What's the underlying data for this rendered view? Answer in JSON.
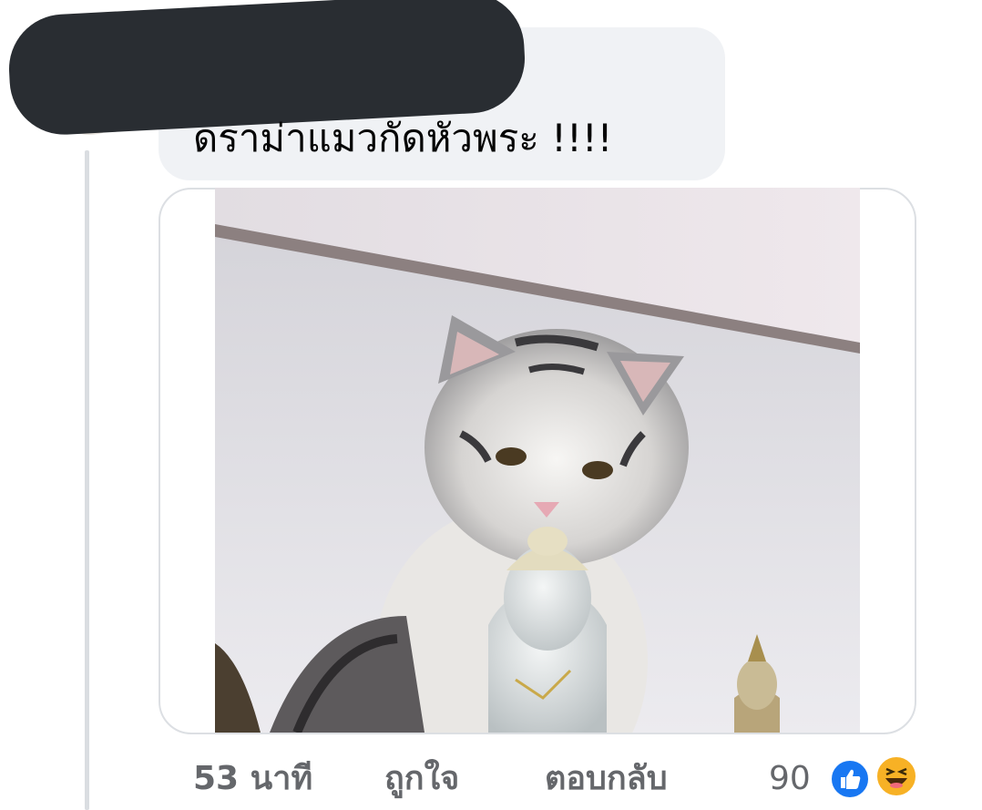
{
  "comment": {
    "text": "ดราม่าแมวกัดหัวพระ !!!!",
    "attachment_icon": "photo-cat-biting-buddha-statue"
  },
  "actions": {
    "time": "53 นาที",
    "like": "ถูกใจ",
    "reply": "ตอบกลับ"
  },
  "reactions": {
    "count": "90",
    "icons": [
      "like-icon",
      "haha-icon"
    ]
  },
  "colors": {
    "bubble": "#f0f2f5",
    "meta_text": "#65676b",
    "like_blue": "#1877f2",
    "haha_yellow": "#f7b125"
  }
}
